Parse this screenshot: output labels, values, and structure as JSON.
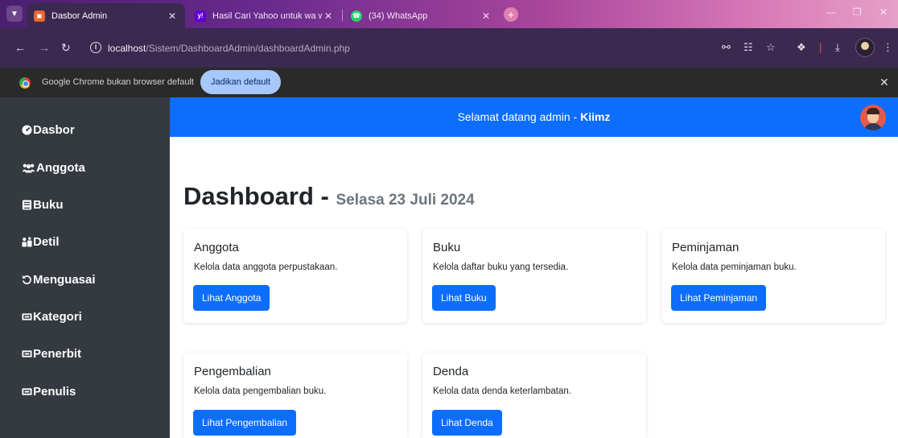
{
  "browser": {
    "tabs": [
      {
        "title": "Dasbor Admin",
        "favicon": "dashboard-favicon",
        "active": true
      },
      {
        "title": "Hasil Cari Yahoo untuk wa web",
        "favicon": "yahoo-favicon",
        "active": false
      },
      {
        "title": "(34) WhatsApp",
        "favicon": "whatsapp-favicon",
        "active": false
      }
    ],
    "url_host": "localhost",
    "url_path": "/Sistem/DashboardAdmin/dashboardAdmin.php",
    "infobar_message": "Google Chrome bukan browser default",
    "infobar_button": "Jadikan default"
  },
  "sidebar": {
    "items": [
      {
        "label": "Dasbor",
        "icon": "dashboard-icon"
      },
      {
        "label": "Anggota",
        "icon": "users-icon"
      },
      {
        "label": "Buku",
        "icon": "book-icon"
      },
      {
        "label": "Detil",
        "icon": "detail-icon"
      },
      {
        "label": "Menguasai",
        "icon": "rotate-icon"
      },
      {
        "label": "Kategori",
        "icon": "ticket-icon"
      },
      {
        "label": "Penerbit",
        "icon": "ticket-icon"
      },
      {
        "label": "Penulis",
        "icon": "ticket-icon"
      }
    ]
  },
  "header": {
    "welcome_prefix": "Selamat datang admin - ",
    "user_name": "Kiimz"
  },
  "main": {
    "title": "Dashboard",
    "separator": " - ",
    "date": "Selasa 23 Juli 2024",
    "cards": [
      {
        "title": "Anggota",
        "text": "Kelola data anggota perpustakaan.",
        "button": "Lihat Anggota"
      },
      {
        "title": "Buku",
        "text": "Kelola daftar buku yang tersedia.",
        "button": "Lihat Buku"
      },
      {
        "title": "Peminjaman",
        "text": "Kelola data peminjaman buku.",
        "button": "Lihat Peminjaman"
      },
      {
        "title": "Pengembalian",
        "text": "Kelola data pengembalian buku.",
        "button": "Lihat Pengembalian"
      },
      {
        "title": "Denda",
        "text": "Kelola data denda keterlambatan.",
        "button": "Lihat Denda"
      }
    ]
  },
  "colors": {
    "primary": "#0d6efd",
    "sidebar_bg": "#343a40"
  }
}
